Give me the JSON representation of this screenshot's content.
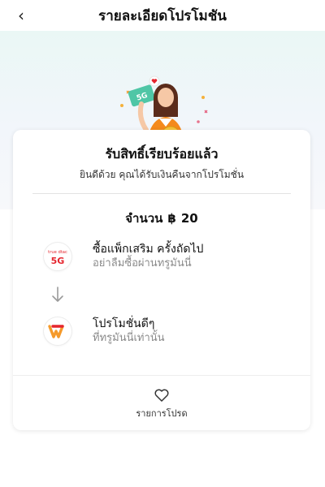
{
  "header": {
    "title": "รายละเอียดโปรโมชัน",
    "back_icon": "chevron-left-icon"
  },
  "illustration": {
    "badge_text": "5G",
    "heart_icon": "heart-icon"
  },
  "result": {
    "title": "รับสิทธิ์เรียบร้อยแล้ว",
    "subtitle": "ยินดีด้วย คุณได้รับเงินคืนจากโปรโมชั่น",
    "amount_label": "จำนวน",
    "currency": "฿",
    "amount_value": "20"
  },
  "steps": [
    {
      "title": "ซื้อแพ็กเสริม ครั้งถัดไป",
      "description": "อย่าลืมซื้อผ่านทรูมันนี่",
      "logo_text_top": "true dtac",
      "logo_text_main": "5G",
      "logo_icon": "true-dtac-5g-logo"
    },
    {
      "title": "โปรโมชั่นดีๆ",
      "description": "ที่ทรูมันนี่เท่านั้น",
      "logo_icon": "truemoney-logo"
    }
  ],
  "favorites": {
    "label": "รายการโปรด",
    "icon": "heart-outline-icon"
  },
  "colors": {
    "accent_orange": "#f59a2b",
    "brand_red": "#e5252e",
    "banner_bg": "#eaf7f5",
    "muted_text": "#8a8a8a"
  }
}
